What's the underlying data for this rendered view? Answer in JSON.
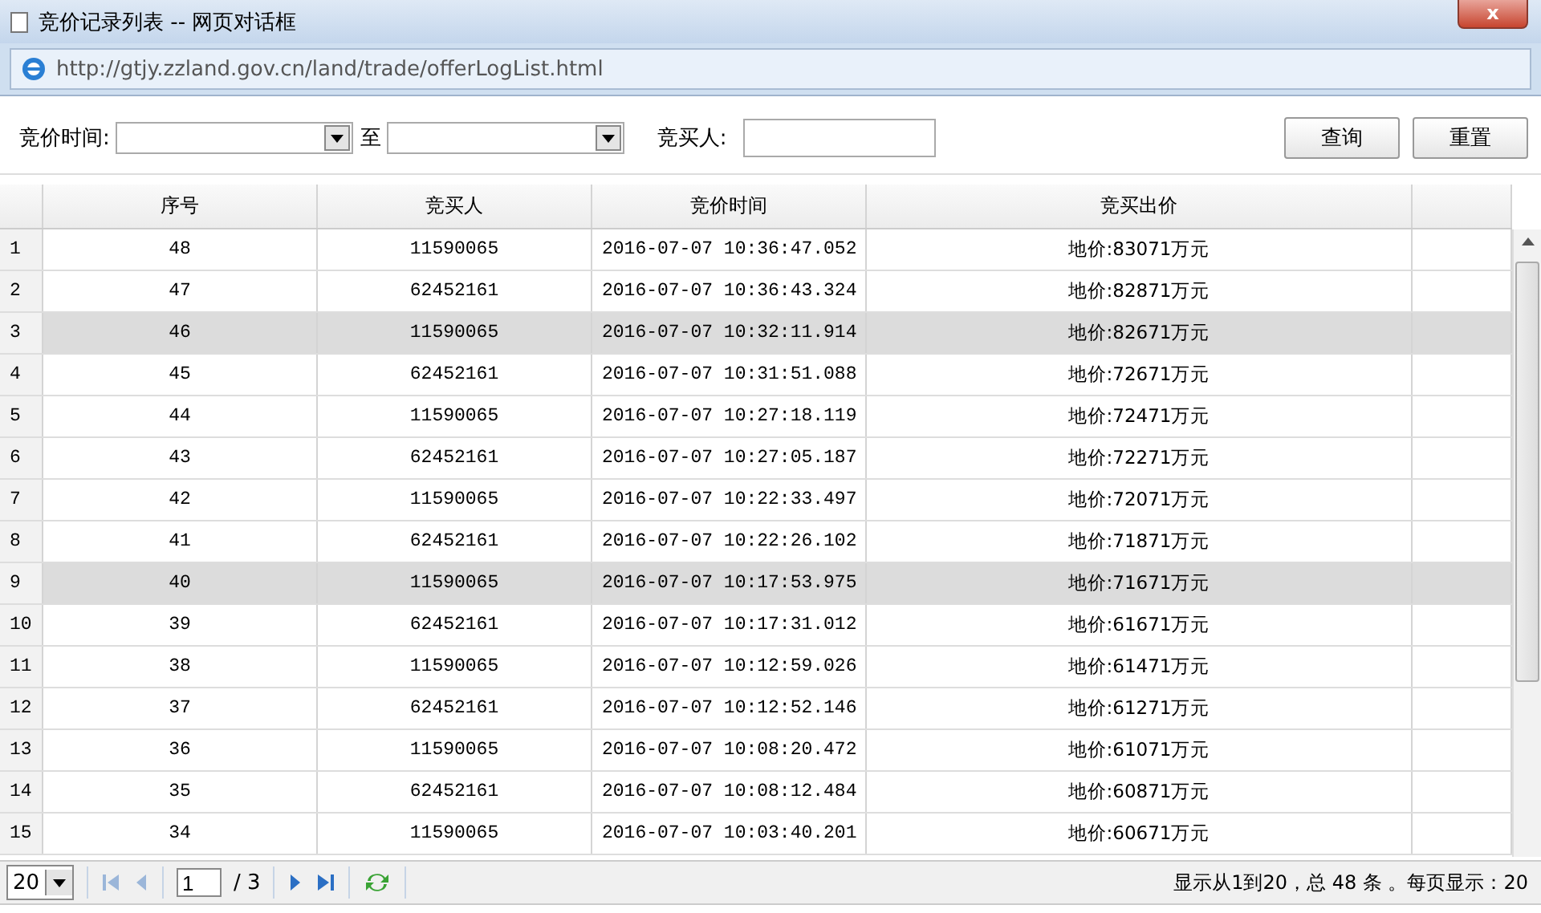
{
  "window": {
    "title": "竞价记录列表 -- 网页对话框",
    "close": "x"
  },
  "address_bar": {
    "url": "http://gtjy.zzland.gov.cn/land/trade/offerLogList.html"
  },
  "filters": {
    "time_label": "竞价时间:",
    "separator": "至",
    "bidder_label": "竞买人:"
  },
  "buttons": [
    "查询",
    "重置"
  ],
  "table": {
    "columns": [
      "序号",
      "竞买人",
      "竞价时间",
      "竞买出价"
    ],
    "rows": [
      {
        "row": "1",
        "cells": [
          "48",
          "11590065",
          "2016-07-07 10:36:47.052",
          "地价:83071万元"
        ],
        "selected": false
      },
      {
        "row": "2",
        "cells": [
          "47",
          "62452161",
          "2016-07-07 10:36:43.324",
          "地价:82871万元"
        ],
        "selected": false
      },
      {
        "row": "3",
        "cells": [
          "46",
          "11590065",
          "2016-07-07 10:32:11.914",
          "地价:82671万元"
        ],
        "selected": true
      },
      {
        "row": "4",
        "cells": [
          "45",
          "62452161",
          "2016-07-07 10:31:51.088",
          "地价:72671万元"
        ],
        "selected": false
      },
      {
        "row": "5",
        "cells": [
          "44",
          "11590065",
          "2016-07-07 10:27:18.119",
          "地价:72471万元"
        ],
        "selected": false
      },
      {
        "row": "6",
        "cells": [
          "43",
          "62452161",
          "2016-07-07 10:27:05.187",
          "地价:72271万元"
        ],
        "selected": false
      },
      {
        "row": "7",
        "cells": [
          "42",
          "11590065",
          "2016-07-07 10:22:33.497",
          "地价:72071万元"
        ],
        "selected": false
      },
      {
        "row": "8",
        "cells": [
          "41",
          "62452161",
          "2016-07-07 10:22:26.102",
          "地价:71871万元"
        ],
        "selected": false
      },
      {
        "row": "9",
        "cells": [
          "40",
          "11590065",
          "2016-07-07 10:17:53.975",
          "地价:71671万元"
        ],
        "selected": true
      },
      {
        "row": "10",
        "cells": [
          "39",
          "62452161",
          "2016-07-07 10:17:31.012",
          "地价:61671万元"
        ],
        "selected": false
      },
      {
        "row": "11",
        "cells": [
          "38",
          "11590065",
          "2016-07-07 10:12:59.026",
          "地价:61471万元"
        ],
        "selected": false
      },
      {
        "row": "12",
        "cells": [
          "37",
          "62452161",
          "2016-07-07 10:12:52.146",
          "地价:61271万元"
        ],
        "selected": false
      },
      {
        "row": "13",
        "cells": [
          "36",
          "11590065",
          "2016-07-07 10:08:20.472",
          "地价:61071万元"
        ],
        "selected": false
      },
      {
        "row": "14",
        "cells": [
          "35",
          "62452161",
          "2016-07-07 10:08:12.484",
          "地价:60871万元"
        ],
        "selected": false
      },
      {
        "row": "15",
        "cells": [
          "34",
          "11590065",
          "2016-07-07 10:03:40.201",
          "地价:60671万元"
        ],
        "selected": false
      }
    ]
  },
  "pager": {
    "page_size": "20",
    "page": "1",
    "total_pages": "/ 3",
    "summary": "显示从1到20，总 48 条 。每页显示：20"
  }
}
